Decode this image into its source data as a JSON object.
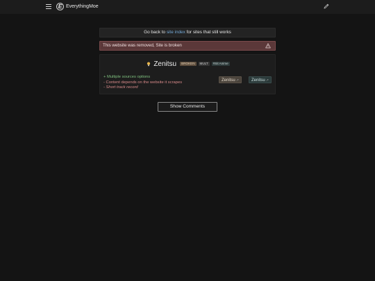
{
  "header": {
    "brand": "EverythingMoe",
    "logo_letter": "E",
    "menu_icon": "hamburger-icon",
    "edit_icon": "pencil-icon"
  },
  "notice": {
    "prefix": "Go back to ",
    "link": "site index",
    "suffix": " for sites that still works"
  },
  "alert": {
    "text": "This website was removed, Site is broken",
    "icon": "warning-icon",
    "color": "#5b3839"
  },
  "site": {
    "icon": "bulb-icon",
    "name": "Zenitsu",
    "tags": [
      "BROKEN",
      "MULT",
      "#Sit Anime"
    ],
    "features": {
      "pros": [
        "+ Multiple sources options"
      ],
      "cons": [
        "- Content depends on the website it scrapes",
        "- Short track record"
      ]
    },
    "links": [
      {
        "label": "Zenitsu",
        "icon": "external-link-icon"
      },
      {
        "label": "Zenitsu",
        "icon": "external-link-icon"
      }
    ]
  },
  "comments": {
    "button_label": "Show Comments"
  },
  "colors": {
    "background": "#141414",
    "link": "#74a9d8",
    "pro": "#7fc07f",
    "con": "#d88a8a"
  }
}
